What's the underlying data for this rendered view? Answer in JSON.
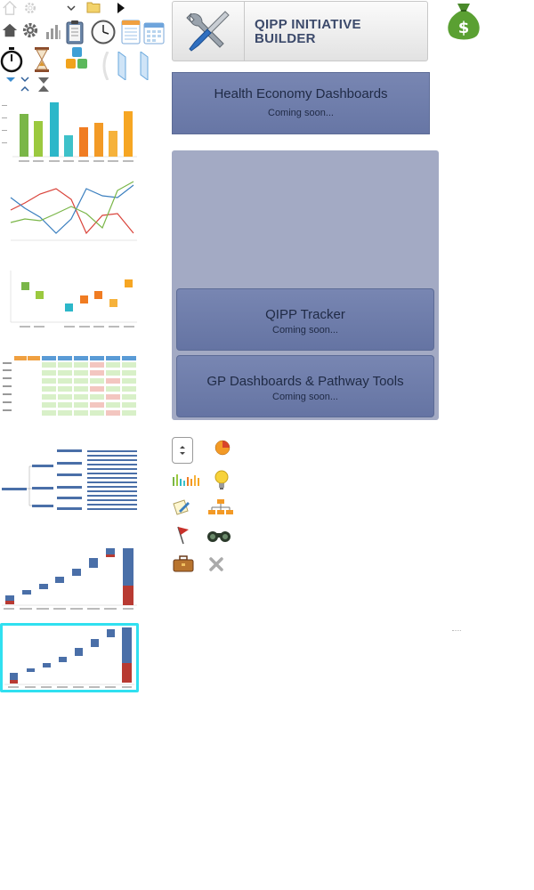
{
  "builder": {
    "line1": "QIPP INITIATIVE",
    "line2": "BUILDER"
  },
  "tiles": {
    "health": {
      "title": "Health Economy Dashboards",
      "subtitle": "Coming soon..."
    },
    "qipp": {
      "title": "QIPP Tracker",
      "subtitle": "Coming soon..."
    },
    "gp": {
      "title": "GP Dashboards & Pathway Tools",
      "subtitle": "Coming soon..."
    }
  },
  "top_icons": [
    "home-outline-icon",
    "gear-outline-icon",
    "chevron-down-icon",
    "folder-icon",
    "play-arrow-icon",
    "home-icon",
    "gear-icon",
    "bar-chart-icon",
    "clipboard-icon",
    "clock-icon",
    "spreadsheet-icon",
    "calendar-icon",
    "stopwatch-icon",
    "hourglass-icon",
    "blocks-icon",
    "page-curl-icon",
    "tab-icon",
    "tab-icon-2",
    "small-chevron-icon",
    "double-chevron-icon",
    "collapse-icon"
  ],
  "icon_grid": [
    "stepper-icon",
    "pie-chart-icon",
    "mini-bars-icon",
    "lightbulb-icon",
    "pencil-note-icon",
    "hierarchy-icon",
    "flag-icon",
    "binoculars-icon",
    "briefcase-icon",
    "close-icon"
  ],
  "colors": {
    "tile": "#6f7faa",
    "panel": "#a3aac4",
    "selection": "#30e0f0"
  },
  "thumbnails": [
    "bar-chart-thumb",
    "line-chart-thumb",
    "scatter-chart-thumb",
    "table-thumb",
    "tree-thumb",
    "waterfall-thumb",
    "waterfall-thumb-selected"
  ]
}
